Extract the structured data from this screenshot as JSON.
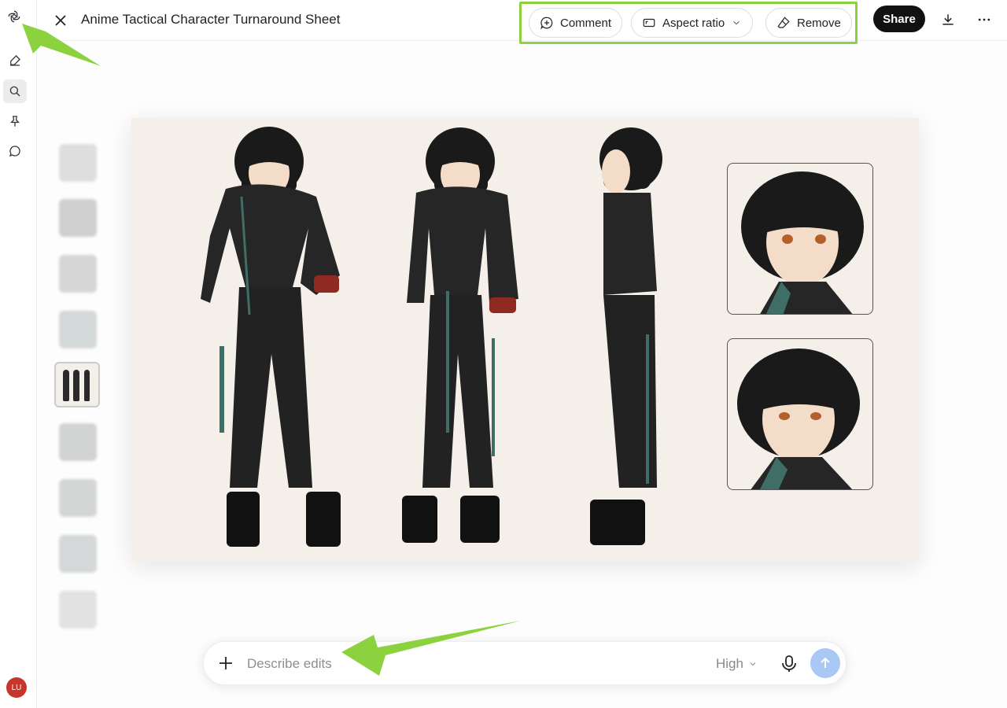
{
  "header": {
    "title": "Anime Tactical Character Turnaround Sheet",
    "share_label": "Share",
    "actions": {
      "comment": "Comment",
      "aspect_ratio": "Aspect ratio",
      "remove": "Remove"
    }
  },
  "sidebar": {
    "avatar_initials": "LU",
    "icons": [
      "openai-logo-icon",
      "new-chat-icon",
      "search-icon",
      "pin-icon",
      "chat-bubble-icon"
    ]
  },
  "thumbnails": {
    "count": 9,
    "selected_index": 4
  },
  "prompt": {
    "placeholder": "Describe edits",
    "quality": "High"
  },
  "colors": {
    "accent_highlight": "#8bd23e",
    "send_button": "#a9c8f5",
    "avatar": "#c6362c",
    "canvas_bg": "#f4efe9"
  }
}
